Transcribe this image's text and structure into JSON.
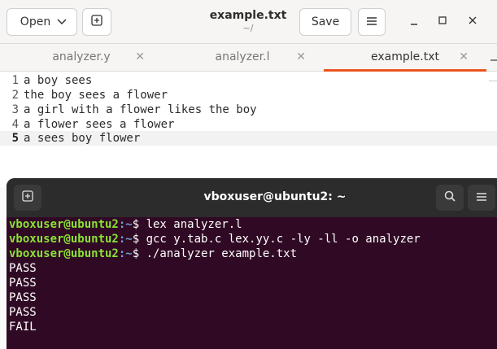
{
  "editor": {
    "open_label": "Open",
    "save_label": "Save",
    "title": "example.txt",
    "path": "~/",
    "tabs": [
      {
        "label": "analyzer.y"
      },
      {
        "label": "analyzer.l"
      },
      {
        "label": "example.txt",
        "active": true
      }
    ],
    "lines": [
      {
        "num": "1",
        "text": "a boy sees"
      },
      {
        "num": "2",
        "text": "the boy sees a flower"
      },
      {
        "num": "3",
        "text": "a girl with a flower likes the boy"
      },
      {
        "num": "4",
        "text": "a flower sees a flower"
      },
      {
        "num": "5",
        "text": "a sees boy flower",
        "current": true
      }
    ],
    "colors": {
      "accent": "#e95420"
    }
  },
  "terminal": {
    "title": "vboxuser@ubuntu2: ~",
    "prompt_user": "vboxuser@ubuntu2",
    "prompt_path": ":~",
    "prompt_symbol": "$ ",
    "commands": [
      "lex analyzer.l",
      "gcc y.tab.c lex.yy.c -ly -ll -o analyzer",
      "./analyzer example.txt"
    ],
    "outputs": [
      "PASS",
      "PASS",
      "PASS",
      "PASS",
      "FAIL"
    ],
    "colors": {
      "background": "#300a24",
      "user": "#8ae234",
      "path": "#729fcf"
    }
  }
}
